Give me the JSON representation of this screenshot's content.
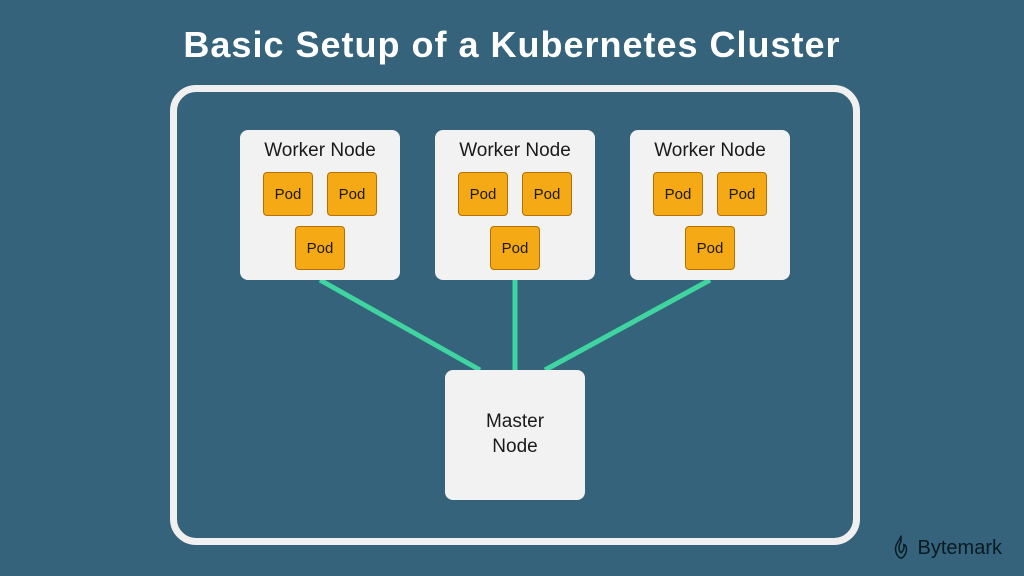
{
  "title": "Basic Setup of a Kubernetes Cluster",
  "workers": [
    {
      "label": "Worker Node",
      "pods": [
        "Pod",
        "Pod",
        "Pod"
      ]
    },
    {
      "label": "Worker Node",
      "pods": [
        "Pod",
        "Pod",
        "Pod"
      ]
    },
    {
      "label": "Worker Node",
      "pods": [
        "Pod",
        "Pod",
        "Pod"
      ]
    }
  ],
  "master": {
    "label": "Master\nNode"
  },
  "brand": "Bytemark",
  "colors": {
    "background": "#35637b",
    "node_bg": "#f2f2f2",
    "pod_bg": "#f5a914",
    "connection": "#3fd4a0",
    "frame": "#f0f0f0"
  }
}
